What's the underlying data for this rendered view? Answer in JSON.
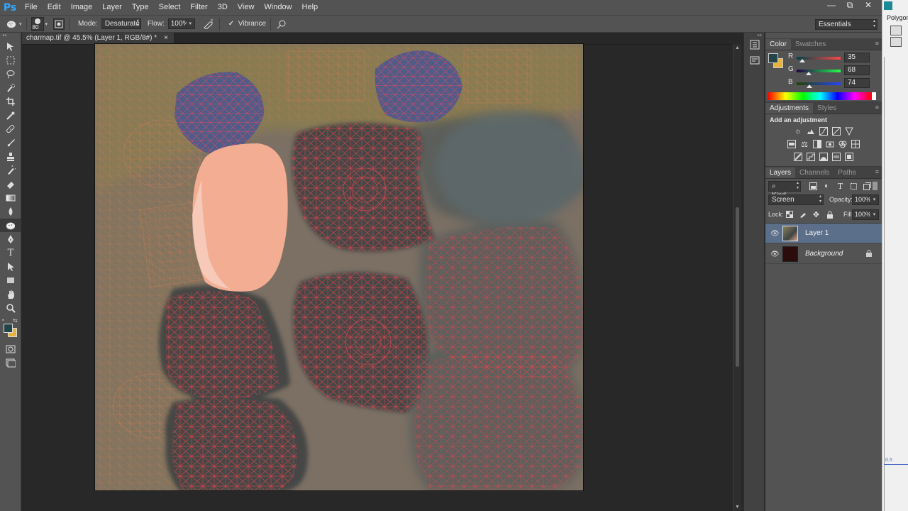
{
  "app": {
    "logo": "Ps",
    "menu": [
      "File",
      "Edit",
      "Image",
      "Layer",
      "Type",
      "Select",
      "Filter",
      "3D",
      "View",
      "Window",
      "Help"
    ]
  },
  "window_controls": {
    "minimize": "—",
    "restore": "⧉",
    "close": "✕"
  },
  "options": {
    "brush_size": "80",
    "mode_label": "Mode:",
    "mode_value": "Desaturate",
    "flow_label": "Flow:",
    "flow_value": "100%",
    "vibrance_label": "Vibrance",
    "vibrance_checked": true,
    "workspace": "Essentials"
  },
  "document": {
    "tab_title": "charmap.tif @ 45.5% (Layer 1, RGB/8#) *",
    "tab_close": "×"
  },
  "color_panel": {
    "tabs": [
      "Color",
      "Swatches"
    ],
    "channels": [
      {
        "label": "R",
        "value": "35",
        "fraction": 0.137
      },
      {
        "label": "G",
        "value": "68",
        "fraction": 0.267
      },
      {
        "label": "B",
        "value": "74",
        "fraction": 0.29
      }
    ],
    "foreground": "#234448",
    "background": "#e6b340"
  },
  "adjustments_panel": {
    "tabs": [
      "Adjustments",
      "Styles"
    ],
    "heading": "Add an adjustment"
  },
  "layers_panel": {
    "tabs": [
      "Layers",
      "Channels",
      "Paths"
    ],
    "filter_kind": "Kind",
    "blend_mode": "Screen",
    "opacity_label": "Opacity:",
    "opacity_value": "100%",
    "lock_label": "Lock:",
    "fill_label": "Fill:",
    "fill_value": "100%",
    "layers": [
      {
        "name": "Layer 1",
        "selected": true
      },
      {
        "name": "Background",
        "selected": false,
        "locked": true
      }
    ]
  },
  "far_right": {
    "label": "Polygon",
    "tick": "0.5"
  }
}
